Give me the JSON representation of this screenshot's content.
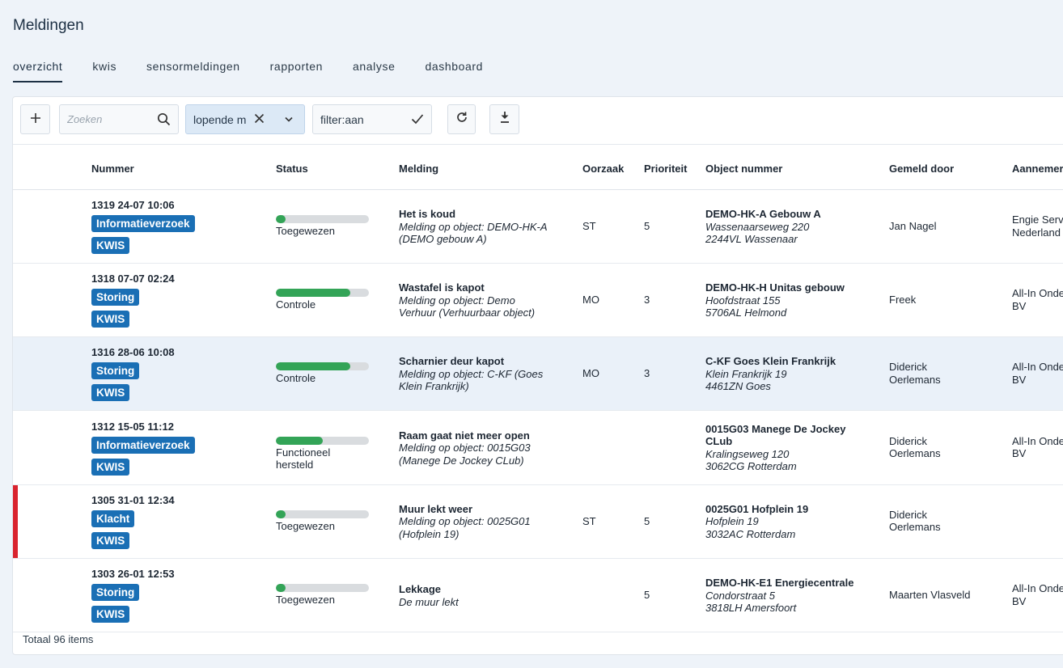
{
  "page": {
    "title": "Meldingen"
  },
  "tabs": [
    {
      "label": "overzicht",
      "active": true
    },
    {
      "label": "kwis",
      "active": false
    },
    {
      "label": "sensormeldingen",
      "active": false
    },
    {
      "label": "rapporten",
      "active": false
    },
    {
      "label": "analyse",
      "active": false
    },
    {
      "label": "dashboard",
      "active": false
    }
  ],
  "toolbar": {
    "add_icon": "plus-icon",
    "search_placeholder": "Zoeken",
    "search_icon": "search-icon",
    "filter_select_value": "lopende m",
    "filter_toggle_value": "filter:aan",
    "refresh_icon": "refresh-icon",
    "download_icon": "download-icon"
  },
  "columns": [
    "Nummer",
    "Status",
    "Melding",
    "Oorzaak",
    "Prioriteit",
    "Object nummer",
    "Gemeld door",
    "Aannemer"
  ],
  "rows": [
    {
      "number": "1319 24-07 10:06",
      "type": "Informatieverzoek",
      "tag": "KWIS",
      "status": "Toegewezen",
      "status_line2": "",
      "progress": 0.1,
      "melding_title": "Het is koud",
      "melding_line1": "Melding op object: DEMO-HK-A",
      "melding_line2": "(DEMO gebouw A)",
      "oorzaak": "ST",
      "prioriteit": "5",
      "object_title": "DEMO-HK-A Gebouw A",
      "object_title2": "",
      "object_line1": "Wassenaarseweg 220",
      "object_line2": "2244VL Wassenaar",
      "gemeld_door": "Jan Nagel",
      "gemeld_door2": "",
      "aannemer": "Engie Serv",
      "aannemer2": "Nederland",
      "highlight": false,
      "urgent": false
    },
    {
      "number": "1318 07-07 02:24",
      "type": "Storing",
      "tag": "KWIS",
      "status": "Controle",
      "status_line2": "",
      "progress": 0.8,
      "melding_title": "Wastafel is kapot",
      "melding_line1": "Melding op object: Demo",
      "melding_line2": "Verhuur (Verhuurbaar object)",
      "oorzaak": "MO",
      "prioriteit": "3",
      "object_title": "DEMO-HK-H Unitas gebouw",
      "object_title2": "",
      "object_line1": "Hoofdstraat 155",
      "object_line2": "5706AL Helmond",
      "gemeld_door": "Freek",
      "gemeld_door2": "",
      "aannemer": "All-In Onde",
      "aannemer2": "BV",
      "highlight": false,
      "urgent": false
    },
    {
      "number": "1316 28-06 10:08",
      "type": "Storing",
      "tag": "KWIS",
      "status": "Controle",
      "status_line2": "",
      "progress": 0.8,
      "melding_title": "Scharnier deur kapot",
      "melding_line1": "Melding op object: C-KF (Goes",
      "melding_line2": "Klein Frankrijk)",
      "oorzaak": "MO",
      "prioriteit": "3",
      "object_title": "C-KF Goes Klein Frankrijk",
      "object_title2": "",
      "object_line1": "Klein Frankrijk 19",
      "object_line2": "4461ZN Goes",
      "gemeld_door": "Diderick",
      "gemeld_door2": "Oerlemans",
      "aannemer": "All-In Onde",
      "aannemer2": "BV",
      "highlight": true,
      "urgent": false
    },
    {
      "number": "1312 15-05 11:12",
      "type": "Informatieverzoek",
      "tag": "KWIS",
      "status": "Functioneel",
      "status_line2": "hersteld",
      "progress": 0.5,
      "melding_title": "Raam gaat niet meer open",
      "melding_line1": "Melding op object: 0015G03",
      "melding_line2": "(Manege De Jockey CLub)",
      "oorzaak": "",
      "prioriteit": "",
      "object_title": "0015G03 Manege De Jockey",
      "object_title2": "CLub",
      "object_line1": "Kralingseweg 120",
      "object_line2": "3062CG Rotterdam",
      "gemeld_door": "Diderick",
      "gemeld_door2": "Oerlemans",
      "aannemer": "All-In Onde",
      "aannemer2": "BV",
      "highlight": false,
      "urgent": false
    },
    {
      "number": "1305 31-01 12:34",
      "type": "Klacht",
      "tag": "KWIS",
      "status": "Toegewezen",
      "status_line2": "",
      "progress": 0.1,
      "melding_title": "Muur lekt weer",
      "melding_line1": "Melding op object: 0025G01",
      "melding_line2": "(Hofplein 19)",
      "oorzaak": "ST",
      "prioriteit": "5",
      "object_title": "0025G01 Hofplein 19",
      "object_title2": "",
      "object_line1": "Hofplein 19",
      "object_line2": "3032AC Rotterdam",
      "gemeld_door": "Diderick",
      "gemeld_door2": "Oerlemans",
      "aannemer": "",
      "aannemer2": "",
      "highlight": false,
      "urgent": true
    },
    {
      "number": "1303 26-01 12:53",
      "type": "Storing",
      "tag": "KWIS",
      "status": "Toegewezen",
      "status_line2": "",
      "progress": 0.1,
      "melding_title": "Lekkage",
      "melding_line1": "De muur lekt",
      "melding_line2": "",
      "oorzaak": "",
      "prioriteit": "5",
      "object_title": "DEMO-HK-E1 Energiecentrale",
      "object_title2": "",
      "object_line1": "Condorstraat 5",
      "object_line2": "3818LH Amersfoort",
      "gemeld_door": "Maarten Vlasveld",
      "gemeld_door2": "",
      "aannemer": "All-In Onde",
      "aannemer2": "BV",
      "highlight": false,
      "urgent": false
    }
  ],
  "footer": {
    "total": "Totaal 96 items"
  },
  "colors": {
    "accent": "#1a6fb5",
    "progress": "#33a457",
    "urgent": "#d9232e",
    "highlight_row": "#eaf1f9"
  }
}
